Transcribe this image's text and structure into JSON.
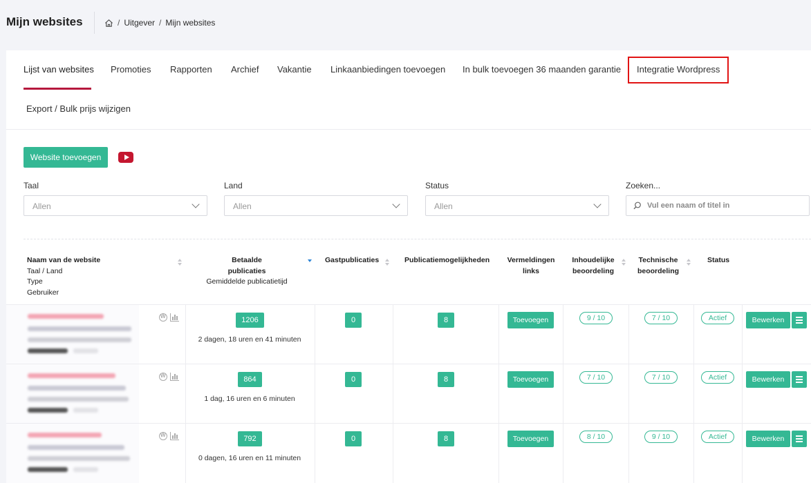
{
  "header": {
    "title": "Mijn websites",
    "breadcrumb": [
      "Uitgever",
      "Mijn websites"
    ]
  },
  "tabs": [
    "Lijst van websites",
    "Promoties",
    "Rapporten",
    "Archief",
    "Vakantie",
    "Linkaanbiedingen toevoegen",
    "In bulk toevoegen 36 maanden garantie",
    "Integratie Wordpress",
    "Export / Bulk prijs wijzigen"
  ],
  "actions": {
    "add_website": "Website toevoegen"
  },
  "filters": {
    "taal": {
      "label": "Taal",
      "value": "Allen"
    },
    "land": {
      "label": "Land",
      "value": "Allen"
    },
    "status": {
      "label": "Status",
      "value": "Allen"
    },
    "search": {
      "label": "Zoeken...",
      "placeholder": "Vul een naam of titel in"
    }
  },
  "table": {
    "headers": {
      "name": [
        "Naam van de website",
        "Taal / Land",
        "Type",
        "Gebruiker"
      ],
      "paid": [
        "Betaalde",
        "publicaties",
        "Gemiddelde publicatietijd"
      ],
      "guest": "Gastpublicaties",
      "possibilities": "Publicatiemogelijkheden",
      "mentions": [
        "Vermeldingen",
        "links"
      ],
      "content": [
        "Inhoudelijke",
        "beoordeling"
      ],
      "technical": [
        "Technische",
        "beoordeling"
      ],
      "status": "Status"
    },
    "rows": [
      {
        "paid": "1206",
        "time": "2 dagen, 18 uren en 41 minuten",
        "guest": "0",
        "possibilities": "8",
        "mentions": "Toevoegen",
        "content": "9 / 10",
        "technical": "7 / 10",
        "status": "Actief",
        "edit": "Bewerken"
      },
      {
        "paid": "864",
        "time": "1 dag, 16 uren en 6 minuten",
        "guest": "0",
        "possibilities": "8",
        "mentions": "Toevoegen",
        "content": "7 / 10",
        "technical": "7 / 10",
        "status": "Actief",
        "edit": "Bewerken"
      },
      {
        "paid": "792",
        "time": "0 dagen, 16 uren en 11 minuten",
        "guest": "0",
        "possibilities": "8",
        "mentions": "Toevoegen",
        "content": "8 / 10",
        "technical": "9 / 10",
        "status": "Actief",
        "edit": "Bewerken"
      }
    ]
  },
  "colors": {
    "accent": "#34b894",
    "active_tab": "#b5173d",
    "highlight": "#e11313"
  }
}
